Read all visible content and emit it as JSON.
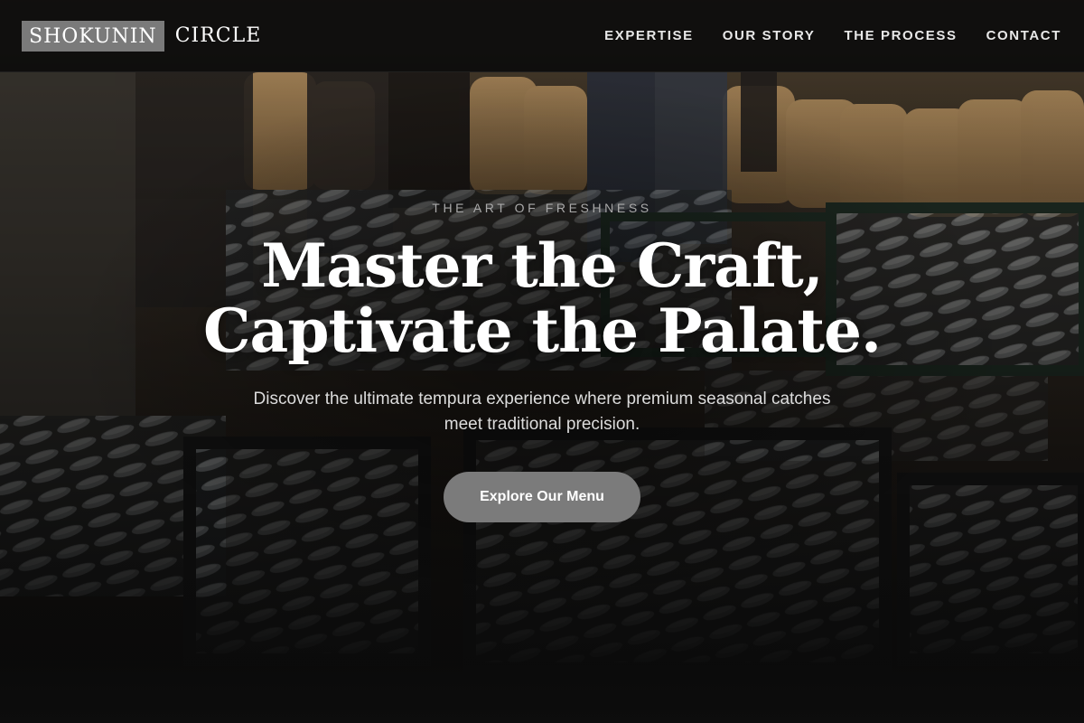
{
  "brand": {
    "logo_box_text": "SHOKUNIN",
    "logo_rest_text": "CIRCLE"
  },
  "nav": {
    "items": [
      {
        "label": "EXPERTISE"
      },
      {
        "label": "OUR STORY"
      },
      {
        "label": "THE PROCESS"
      },
      {
        "label": "CONTACT"
      }
    ]
  },
  "hero": {
    "eyebrow": "THE ART OF FRESHNESS",
    "headline_line1": "Master the Craft,",
    "headline_line2": "Captivate the Palate.",
    "subtext": "Discover the ultimate tempura experience where premium seasonal catches meet traditional precision.",
    "cta_label": "Explore Our Menu",
    "background_image": "fish-market-crates-photo"
  },
  "colors": {
    "header_bg": "#0c0c0c",
    "logo_box_bg": "#7a7a7a",
    "cta_bg": "#7b7b7b",
    "page_bg": "#0d0d0d"
  }
}
